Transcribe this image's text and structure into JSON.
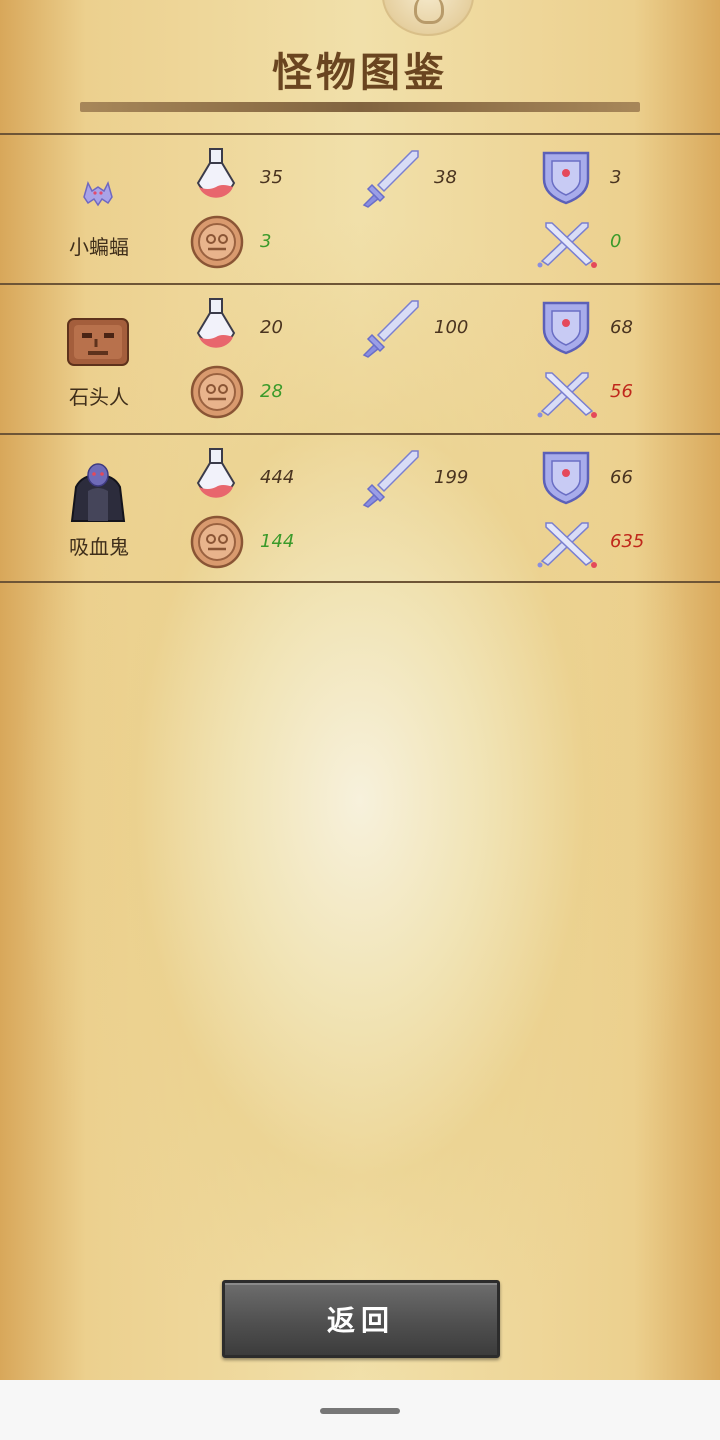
{
  "header": {
    "title": "怪物图鉴"
  },
  "monsters": [
    {
      "name": "小蝙蝠",
      "portrait_icon": "bat-icon",
      "hp": "35",
      "atk": "38",
      "def": "3",
      "gold": "3",
      "damage": "0",
      "damage_color": "#3a9a2a"
    },
    {
      "name": "石头人",
      "portrait_icon": "stone-golem-icon",
      "hp": "20",
      "atk": "100",
      "def": "68",
      "gold": "28",
      "damage": "56",
      "damage_color": "#c0281c"
    },
    {
      "name": "吸血鬼",
      "portrait_icon": "vampire-icon",
      "hp": "444",
      "atk": "199",
      "def": "66",
      "gold": "144",
      "damage": "635",
      "damage_color": "#c0281c"
    }
  ],
  "stat_icons": [
    "potion-icon",
    "sword-icon",
    "shield-icon",
    "coin-icon",
    "crossed-swords-icon"
  ],
  "footer": {
    "back_label": "返回"
  },
  "colors": {
    "text": "#4a3420",
    "gold_text": "#3a9a2a",
    "danger_text": "#c0281c",
    "divider": "#6e5536"
  }
}
